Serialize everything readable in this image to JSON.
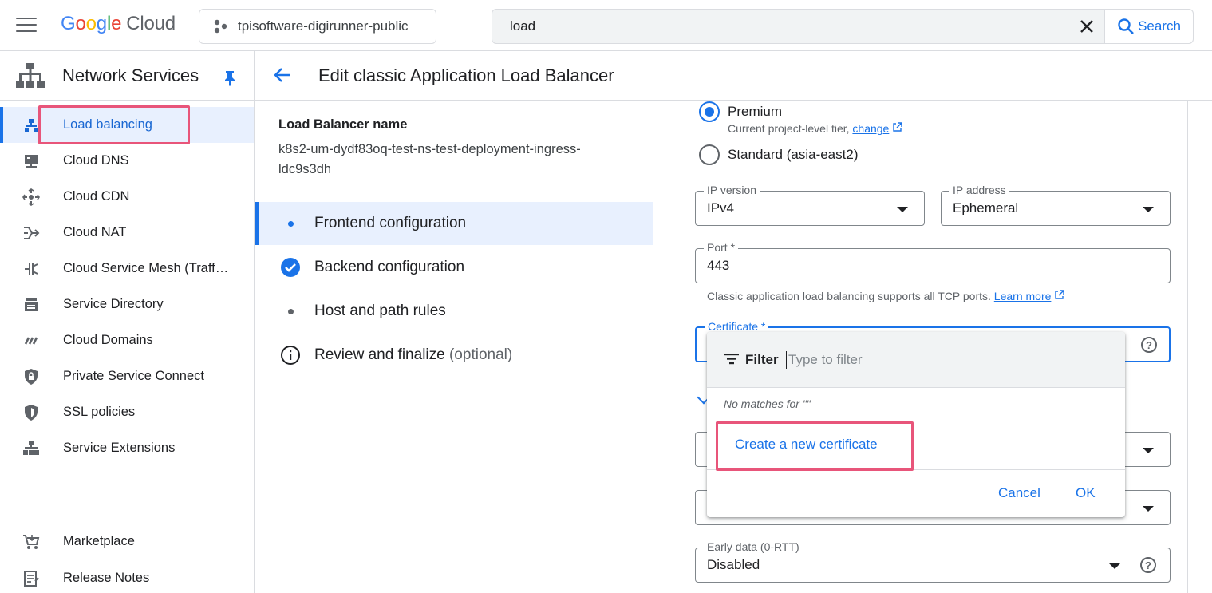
{
  "header": {
    "logo": {
      "letters": [
        "G",
        "o",
        "o",
        "g",
        "l",
        "e"
      ],
      "product": "Cloud"
    },
    "project": "tpisoftware-digirunner-public",
    "search": {
      "value": "load",
      "button": "Search"
    }
  },
  "sidebar": {
    "title": "Network Services",
    "items": [
      {
        "label": "Load balancing",
        "icon": "load-balancing-icon",
        "active": true
      },
      {
        "label": "Cloud DNS",
        "icon": "dns-icon"
      },
      {
        "label": "Cloud CDN",
        "icon": "cdn-icon"
      },
      {
        "label": "Cloud NAT",
        "icon": "nat-icon"
      },
      {
        "label": "Cloud Service Mesh (Traff…",
        "icon": "service-mesh-icon"
      },
      {
        "label": "Service Directory",
        "icon": "service-directory-icon"
      },
      {
        "label": "Cloud Domains",
        "icon": "domains-icon"
      },
      {
        "label": "Private Service Connect",
        "icon": "private-connect-icon"
      },
      {
        "label": "SSL policies",
        "icon": "shield-icon"
      },
      {
        "label": "Service Extensions",
        "icon": "extensions-icon"
      }
    ],
    "footer": [
      {
        "label": "Marketplace",
        "icon": "cart-icon"
      },
      {
        "label": "Release Notes",
        "icon": "notes-icon"
      }
    ]
  },
  "page": {
    "title": "Edit classic Application Load Balancer"
  },
  "steps_panel": {
    "lb_name_label": "Load Balancer name",
    "lb_name_value": "k8s2-um-dydf83oq-test-ns-test-deployment-ingress-ldc9s3dh",
    "steps": [
      {
        "label": "Frontend configuration",
        "optional": "",
        "state": "active"
      },
      {
        "label": "Backend configuration",
        "optional": "",
        "state": "done"
      },
      {
        "label": "Host and path rules",
        "optional": "",
        "state": "pending"
      },
      {
        "label": "Review and finalize",
        "optional": "(optional)",
        "state": "info"
      }
    ]
  },
  "form": {
    "tier_premium": "Premium",
    "tier_note": "Current project-level tier,",
    "tier_change_link": "change",
    "tier_standard": "Standard (asia-east2)",
    "ip_version": {
      "label": "IP version",
      "value": "IPv4"
    },
    "ip_address": {
      "label": "IP address",
      "value": "Ephemeral"
    },
    "port": {
      "label": "Port *",
      "value": "443"
    },
    "port_note": "Classic application load balancing supports all TCP ports.",
    "port_learn_more": "Learn more",
    "certificate": {
      "label": "Certificate *",
      "value": ""
    },
    "early_data": {
      "label": "Early data (0-RTT)",
      "value": "Disabled"
    }
  },
  "dropdown": {
    "filter_label": "Filter",
    "filter_placeholder": "Type to filter",
    "no_matches": "No matches for \"\"",
    "create_new": "Create a new certificate",
    "cancel": "Cancel",
    "ok": "OK"
  },
  "colors": {
    "accent": "#1a73e8",
    "highlight": "#e8557a",
    "active_bg": "#e8f0fe"
  }
}
